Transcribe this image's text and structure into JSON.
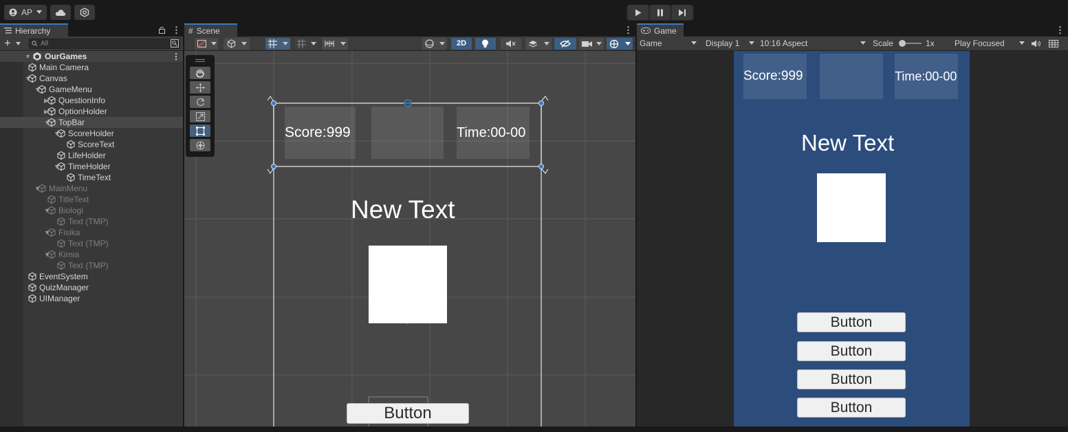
{
  "toolbar": {
    "account_label": "AP",
    "account_icon": "account-icon",
    "cloud_icon": "cloud-icon",
    "collab_icon": "collab-icon",
    "play_icon": "play-icon",
    "pause_icon": "pause-icon",
    "step_icon": "step-icon"
  },
  "hierarchy": {
    "tab_label": "Hierarchy",
    "search_placeholder": "All",
    "scene_name": "OurGames",
    "items": [
      {
        "label": "Main Camera",
        "inactive": false,
        "arrow": ""
      },
      {
        "label": "Canvas",
        "inactive": false,
        "arrow": "▼"
      },
      {
        "label": "GameMenu",
        "inactive": false,
        "arrow": "▼"
      },
      {
        "label": "QuestionInfo",
        "inactive": false,
        "arrow": "▶"
      },
      {
        "label": "OptionHolder",
        "inactive": false,
        "arrow": "▶"
      },
      {
        "label": "TopBar",
        "inactive": false,
        "arrow": "▼",
        "selected": true
      },
      {
        "label": "ScoreHolder",
        "inactive": false,
        "arrow": "▼"
      },
      {
        "label": "ScoreText",
        "inactive": false,
        "arrow": ""
      },
      {
        "label": "LifeHolder",
        "inactive": false,
        "arrow": ""
      },
      {
        "label": "TimeHolder",
        "inactive": false,
        "arrow": "▼"
      },
      {
        "label": "TimeText",
        "inactive": false,
        "arrow": ""
      },
      {
        "label": "MainMenu",
        "inactive": true,
        "arrow": "▼"
      },
      {
        "label": "TitleText",
        "inactive": true,
        "arrow": ""
      },
      {
        "label": "Biologi",
        "inactive": true,
        "arrow": "▼"
      },
      {
        "label": "Text (TMP)",
        "inactive": true,
        "arrow": ""
      },
      {
        "label": "Fisika",
        "inactive": true,
        "arrow": "▼"
      },
      {
        "label": "Text (TMP)",
        "inactive": true,
        "arrow": ""
      },
      {
        "label": "Kimia",
        "inactive": true,
        "arrow": "▼"
      },
      {
        "label": "Text (TMP)",
        "inactive": true,
        "arrow": ""
      },
      {
        "label": "EventSystem",
        "inactive": false,
        "arrow": ""
      },
      {
        "label": "QuizManager",
        "inactive": false,
        "arrow": ""
      },
      {
        "label": "UIManager",
        "inactive": false,
        "arrow": ""
      }
    ]
  },
  "scene": {
    "tab_label": "Scene",
    "mode_2d": "2D",
    "score_text": "Score:999",
    "time_text": "Time:00-00",
    "title_text": "New Text",
    "button_label": "Button"
  },
  "game": {
    "tab_label": "Game",
    "view_select": "Game",
    "display_select": "Display 1",
    "aspect_select": "10:16 Aspect",
    "scale_label": "Scale",
    "scale_value": "1x",
    "play_mode": "Play Focused",
    "score_text": "Score:999",
    "time_text": "Time:00-00",
    "title_text": "New Text",
    "buttons": [
      "Button",
      "Button",
      "Button",
      "Button"
    ]
  },
  "colors": {
    "selection_blue": "#3a79bb",
    "game_background": "#2c4d7b",
    "editor_dark": "#191919"
  }
}
